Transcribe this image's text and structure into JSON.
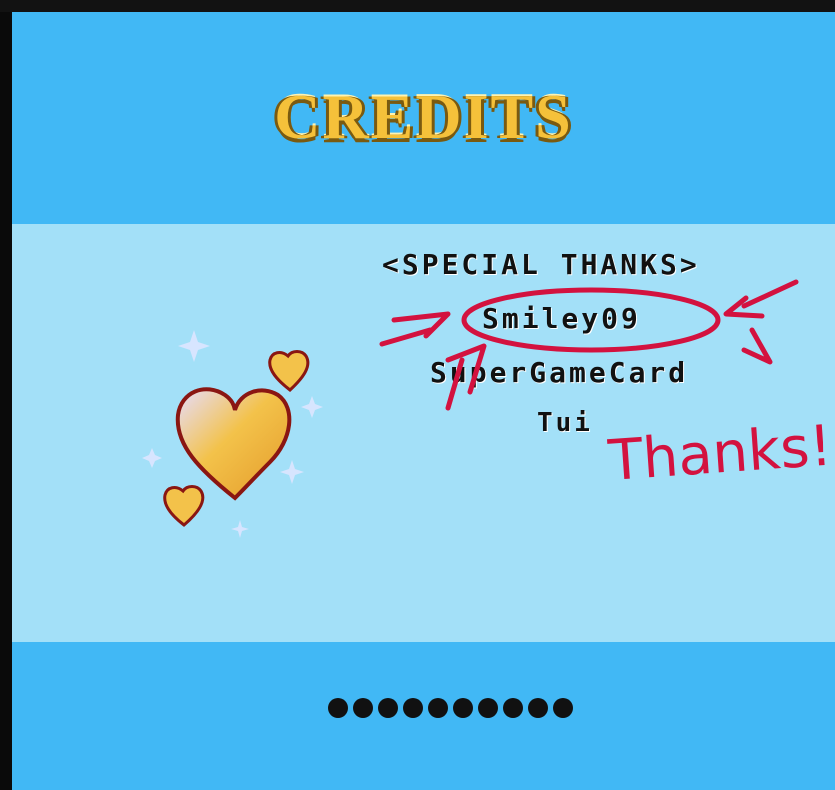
{
  "title": "CREDITS",
  "special_thanks": {
    "header": "<SPECIAL THANKS>",
    "names": [
      "Smiley09",
      "SuperGameCard",
      "Tui"
    ]
  },
  "annotation": {
    "text": "Thanks!",
    "color": "#d3123f"
  },
  "progress": {
    "dot_count": 10
  },
  "colors": {
    "sky_blue": "#41b8f5",
    "light_blue": "#a3e0f8",
    "gold": "#f5c13a",
    "text": "#111111"
  }
}
